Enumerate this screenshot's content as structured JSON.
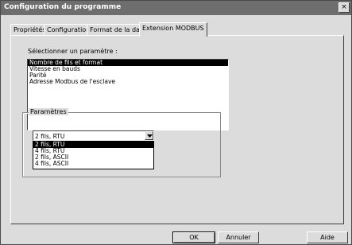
{
  "window": {
    "title": "Configuration du programme",
    "close_glyph": "×"
  },
  "tabs": [
    {
      "label": "Propriétés"
    },
    {
      "label": "Configuration"
    },
    {
      "label": "Format de la date"
    },
    {
      "label": "Extension MODBUS",
      "active": true
    }
  ],
  "parameters": {
    "select_label": "Sélectionner un paramètre :",
    "items": [
      {
        "label": "Nombre de fils et format",
        "selected": true
      },
      {
        "label": "Vitesse en bauds"
      },
      {
        "label": "Parité"
      },
      {
        "label": "Adresse Modbus de l'esclave"
      }
    ]
  },
  "params_group": {
    "legend": "Paramètres",
    "combo_value": "2 fils, RTU",
    "options": [
      {
        "label": "2 fils, RTU",
        "selected": true
      },
      {
        "label": "4 fils, RTU"
      },
      {
        "label": "2 fils, ASCII"
      },
      {
        "label": "4 fils, ASCII"
      }
    ]
  },
  "buttons": {
    "ok": "OK",
    "cancel": "Annuler",
    "help": "Aide"
  }
}
